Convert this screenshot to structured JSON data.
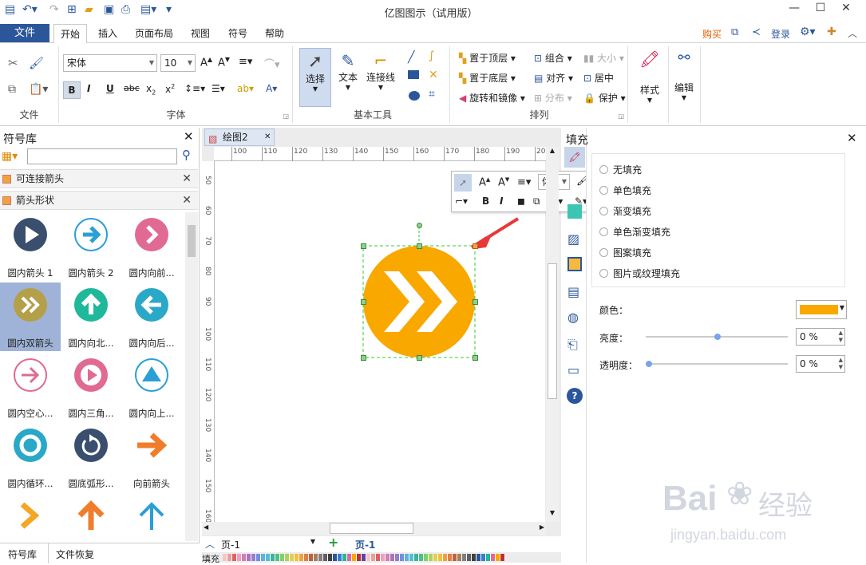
{
  "title": "亿图图示（试用版）",
  "menu": {
    "file": "文件",
    "tabs": [
      "开始",
      "插入",
      "页面布局",
      "视图",
      "符号",
      "帮助"
    ],
    "buy": "购买",
    "login": "登录"
  },
  "ribbon": {
    "font_name": "宋体",
    "font_size": "10",
    "groups": {
      "file": "文件",
      "font": "字体",
      "tools": "基本工具",
      "arrange": "排列"
    },
    "tools": {
      "select": "选择",
      "text": "文本",
      "connector": "连接线"
    },
    "arrange": {
      "bring_front": "置于顶层",
      "send_back": "置于底层",
      "rotate_mirror": "旋转和镜像",
      "group": "组合",
      "align": "对齐",
      "distribute": "分布",
      "size": "大小",
      "center": "居中",
      "protect": "保护"
    },
    "style": "样式",
    "edit": "编辑"
  },
  "library": {
    "title": "符号库",
    "search_placeholder": "",
    "sections": [
      "可连接箭头",
      "箭头形状"
    ],
    "shapes": [
      {
        "label": "圆内箭头 1",
        "icon": "circle-play-icon",
        "color": "#3a4e6e"
      },
      {
        "label": "圆内箭头 2",
        "icon": "circle-arrow-right-outline-icon",
        "color": "#2a9fd6"
      },
      {
        "label": "圆内向前...",
        "icon": "circle-chevron-right-icon",
        "color": "#e06a93"
      },
      {
        "label": "圆内双箭头",
        "icon": "circle-double-chevron-icon",
        "color": "#b5a04a"
      },
      {
        "label": "圆内向北...",
        "icon": "circle-arrow-up-icon",
        "color": "#1fb89a"
      },
      {
        "label": "圆内向后...",
        "icon": "circle-arrow-left-icon",
        "color": "#2aa8c8"
      },
      {
        "label": "圆内空心...",
        "icon": "circle-arrow-right-hollow-icon",
        "color": "#e06a93"
      },
      {
        "label": "圆内三角...",
        "icon": "circle-triangle-icon",
        "color": "#e06a93"
      },
      {
        "label": "圆内向上...",
        "icon": "circle-triangle-up-icon",
        "color": "#2a9fd6"
      },
      {
        "label": "圆内循环...",
        "icon": "circle-refresh-icon",
        "color": "#2aa8c8"
      },
      {
        "label": "圆底弧形...",
        "icon": "circle-arc-arrow-icon",
        "color": "#3a4e6e"
      },
      {
        "label": "向前箭头",
        "icon": "arrow-right-icon",
        "color": "#f07d2b"
      },
      {
        "label": "",
        "icon": "chevron-right-icon",
        "color": "#f5a623"
      },
      {
        "label": "",
        "icon": "arrow-up-orange-icon",
        "color": "#f07d2b"
      },
      {
        "label": "",
        "icon": "arrow-up-blue-icon",
        "color": "#2a9fd6"
      }
    ],
    "bottom_tabs": [
      "符号库",
      "文件恢复"
    ]
  },
  "canvas": {
    "tab": "绘图2",
    "hruler": [
      "100",
      "110",
      "120",
      "130",
      "140",
      "150",
      "160",
      "170",
      "180",
      "190",
      "20"
    ],
    "vruler": [
      "50",
      "60",
      "70",
      "80",
      "90",
      "100",
      "110",
      "120",
      "130",
      "140",
      "150",
      "160"
    ],
    "page_select": "页-1",
    "page_tab": "页-1",
    "fill_label": "填充",
    "float_font": "体",
    "shape_color": "#f9a800"
  },
  "fill_panel": {
    "title": "填充",
    "options": [
      "无填充",
      "单色填充",
      "渐变填充",
      "单色渐变填充",
      "图案填充",
      "图片或纹理填充"
    ],
    "color_label": "颜色：",
    "color_value": "#f9a800",
    "brightness_label": "亮度：",
    "brightness_value": "0 %",
    "transparency_label": "透明度：",
    "transparency_value": "0 %"
  },
  "watermark": {
    "brand": "Bai",
    "brand2": "经验",
    "url": "jingyan.baidu.com"
  }
}
